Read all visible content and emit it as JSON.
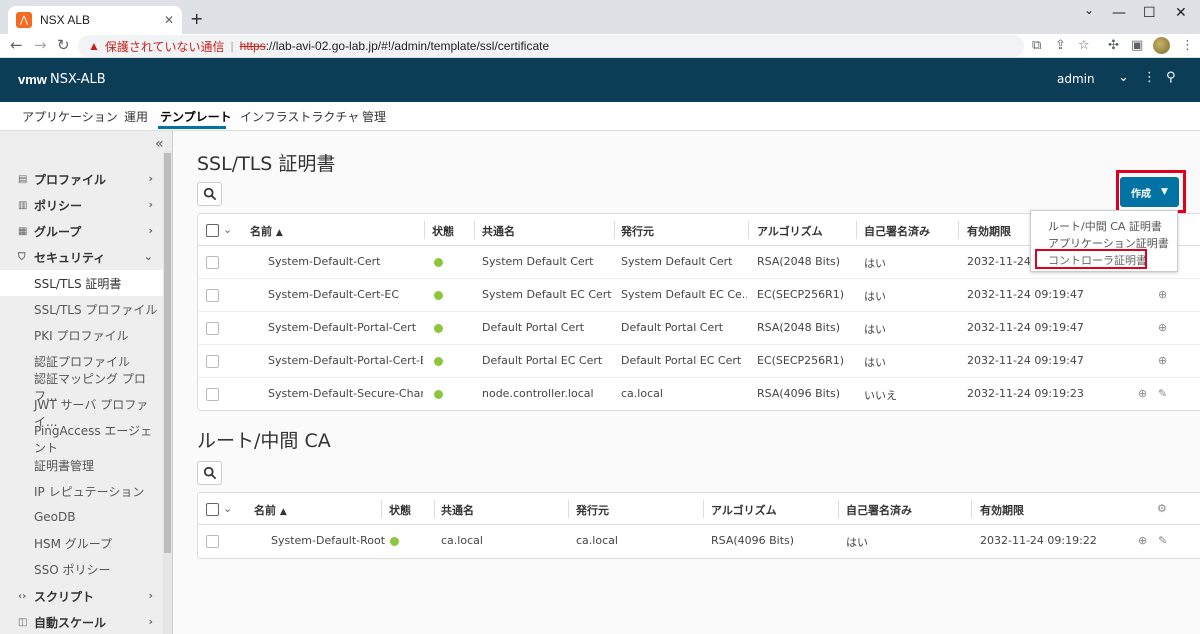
{
  "browser": {
    "tab_title": "NSX ALB",
    "warning_text": "保護されていない通信",
    "url_scheme": "https",
    "url_rest": "://lab-avi-02.go-lab.jp/#!/admin/template/ssl/certificate"
  },
  "header": {
    "logo": "vmw",
    "title": "NSX-ALB",
    "user": "admin"
  },
  "topnav": {
    "items": [
      "アプリケーション",
      "運用",
      "テンプレート",
      "インフラストラクチャ",
      "管理"
    ],
    "active": "テンプレート"
  },
  "sidebar": {
    "groups": [
      {
        "label": "プロファイル"
      },
      {
        "label": "ポリシー"
      },
      {
        "label": "グループ"
      },
      {
        "label": "セキュリティ"
      },
      {
        "label": "スクリプト"
      },
      {
        "label": "自動スケール"
      }
    ],
    "security_items": [
      "SSL/TLS 証明書",
      "SSL/TLS プロファイル",
      "PKI プロファイル",
      "認証プロファイル",
      "認証マッピング プロフ...",
      "JWT サーバ プロファイ...",
      "PingAccess エージェント",
      "証明書管理",
      "IP レピュテーション",
      "GeoDB",
      "HSM グループ",
      "SSO ポリシー"
    ],
    "active_item": "SSL/TLS 証明書"
  },
  "ssl_section": {
    "title": "SSL/TLS 証明書",
    "columns": [
      "名前",
      "状態",
      "共通名",
      "発行元",
      "アルゴリズム",
      "自己署名済み",
      "有効期限"
    ],
    "rows": [
      {
        "name": "System-Default-Cert",
        "cn": "System Default Cert",
        "issuer": "System Default Cert",
        "algo": "RSA(2048 Bits)",
        "self": "はい",
        "exp": "2032-11-24 0"
      },
      {
        "name": "System-Default-Cert-EC",
        "cn": "System Default EC Cert",
        "issuer": "System Default EC Ce...",
        "algo": "EC(SECP256R1)",
        "self": "はい",
        "exp": "2032-11-24 09:19:47"
      },
      {
        "name": "System-Default-Portal-Cert",
        "cn": "Default Portal Cert",
        "issuer": "Default Portal Cert",
        "algo": "RSA(2048 Bits)",
        "self": "はい",
        "exp": "2032-11-24 09:19:47"
      },
      {
        "name": "System-Default-Portal-Cert-EC",
        "cn": "Default Portal EC Cert",
        "issuer": "Default Portal EC Cert",
        "algo": "EC(SECP256R1)",
        "self": "はい",
        "exp": "2032-11-24 09:19:47"
      },
      {
        "name": "System-Default-Secure-Channel",
        "cn": "node.controller.local",
        "issuer": "ca.local",
        "algo": "RSA(4096 Bits)",
        "self": "いいえ",
        "exp": "2032-11-24 09:19:23"
      }
    ]
  },
  "ca_section": {
    "title": "ルート/中間 CA",
    "columns": [
      "名前",
      "状態",
      "共通名",
      "発行元",
      "アルゴリズム",
      "自己署名済み",
      "有効期限"
    ],
    "rows": [
      {
        "name": "System-Default-Root",
        "cn": "ca.local",
        "issuer": "ca.local",
        "algo": "RSA(4096 Bits)",
        "self": "はい",
        "exp": "2032-11-24 09:19:22"
      }
    ]
  },
  "create": {
    "label": "作成",
    "menu": [
      "ルート/中間 CA 証明書",
      "アプリケーション証明書",
      "コントローラ証明書"
    ]
  },
  "colors": {
    "header_bg": "#0c3d57",
    "accent": "#0072a3",
    "status_green": "#8cc63f",
    "highlight_red": "#e0001e"
  }
}
